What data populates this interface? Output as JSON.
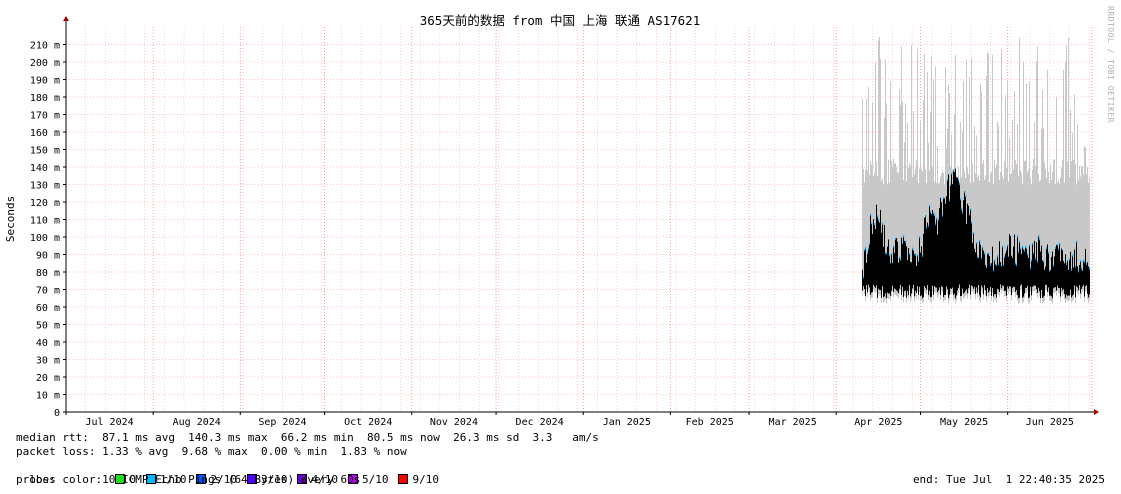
{
  "chart_data": {
    "type": "area",
    "title": "365天前的数据 from 中国 上海 联通 AS17621",
    "ylabel": "Seconds",
    "xlabel": "",
    "ylim": [
      0,
      220
    ],
    "y_ticks": [
      "0",
      "10 m",
      "20 m",
      "30 m",
      "40 m",
      "50 m",
      "60 m",
      "70 m",
      "80 m",
      "90 m",
      "100 m",
      "110 m",
      "120 m",
      "130 m",
      "140 m",
      "150 m",
      "160 m",
      "170 m",
      "180 m",
      "190 m",
      "200 m",
      "210 m"
    ],
    "y_tick_values": [
      0,
      10,
      20,
      30,
      40,
      50,
      60,
      70,
      80,
      90,
      100,
      110,
      120,
      130,
      140,
      150,
      160,
      170,
      180,
      190,
      200,
      210
    ],
    "x_ticks": [
      "Jul 2024",
      "Aug 2024",
      "Sep 2024",
      "Oct 2024",
      "Nov 2024",
      "Dec 2024",
      "Jan 2025",
      "Feb 2025",
      "Mar 2025",
      "Apr 2025",
      "May 2025",
      "Jun 2025"
    ],
    "x_range": [
      "2024-07-01",
      "2025-07-01"
    ],
    "data_start": "2025-04-10",
    "grid": true,
    "series": [
      {
        "name": "median rtt",
        "color": "#000000",
        "points": [
          [
            "2025-04-10",
            80
          ],
          [
            "2025-04-13",
            105
          ],
          [
            "2025-04-16",
            112
          ],
          [
            "2025-04-19",
            95
          ],
          [
            "2025-04-22",
            90
          ],
          [
            "2025-04-25",
            100
          ],
          [
            "2025-04-28",
            88
          ],
          [
            "2025-05-01",
            92
          ],
          [
            "2025-05-04",
            118
          ],
          [
            "2025-05-07",
            110
          ],
          [
            "2025-05-10",
            125
          ],
          [
            "2025-05-13",
            132
          ],
          [
            "2025-05-16",
            120
          ],
          [
            "2025-05-19",
            105
          ],
          [
            "2025-05-22",
            90
          ],
          [
            "2025-05-25",
            85
          ],
          [
            "2025-05-28",
            88
          ],
          [
            "2025-05-31",
            92
          ],
          [
            "2025-06-03",
            95
          ],
          [
            "2025-06-06",
            88
          ],
          [
            "2025-06-09",
            90
          ],
          [
            "2025-06-12",
            93
          ],
          [
            "2025-06-15",
            87
          ],
          [
            "2025-06-18",
            90
          ],
          [
            "2025-06-21",
            92
          ],
          [
            "2025-06-24",
            88
          ],
          [
            "2025-06-27",
            90
          ],
          [
            "2025-06-30",
            86
          ]
        ]
      }
    ],
    "colors": {
      "median": "#000000",
      "loss_line": "#00a8ff",
      "smoke": "#c8c8c8",
      "grid_minor": "#ffb0b0",
      "grid_major": "#ff8080",
      "axis": "#000000",
      "arrow": "#a00000"
    }
  },
  "stats": {
    "median_rtt": "median rtt:  87.1 ms avg  140.3 ms max  66.2 ms min  80.5 ms now  26.3 ms sd  3.3   am/s",
    "packet_loss": "packet loss: 1.33 % avg  9.68 % max  0.00 % min  1.83 % now",
    "loss_color_label": "loss color:",
    "loss_colors": [
      {
        "label": "0",
        "color": "#20e020"
      },
      {
        "label": "1/10",
        "color": "#00b8ff"
      },
      {
        "label": "2/10",
        "color": "#0050ff"
      },
      {
        "label": "3/10",
        "color": "#5000ff"
      },
      {
        "label": "4/10",
        "color": "#7000d0"
      },
      {
        "label": "5/10",
        "color": "#c000ff"
      },
      {
        "label": "9/10",
        "color": "#ff0000"
      }
    ],
    "probe": "probe:       10 ICMP Echo Pings (64 Bytes) every 60s",
    "end": "end: Tue Jul  1 22:40:35 2025"
  },
  "watermark": "RRDTOOL / TOBI OETIKER"
}
